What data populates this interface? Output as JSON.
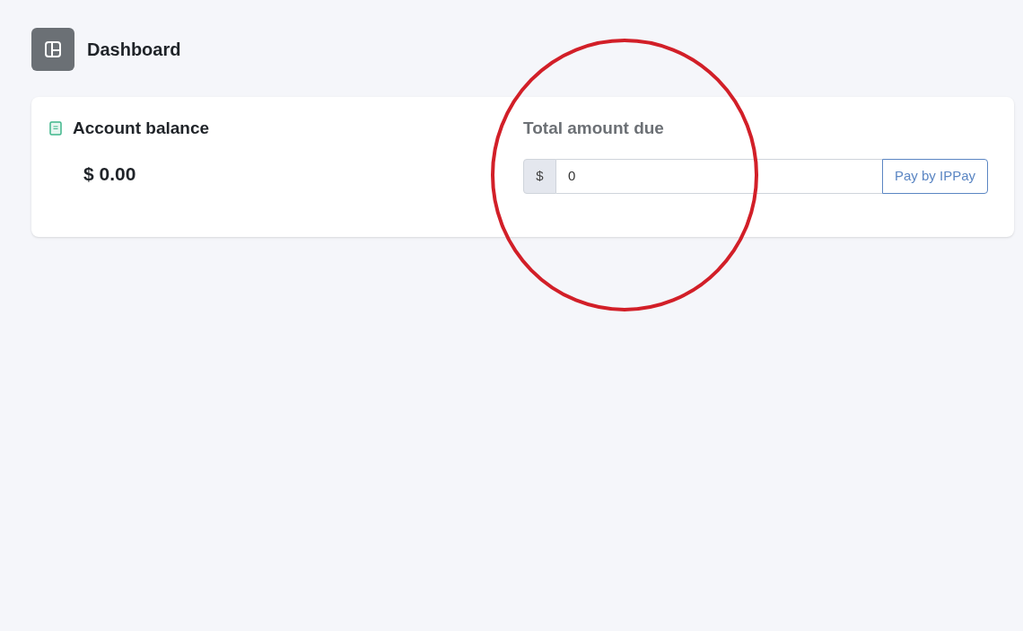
{
  "header": {
    "title": "Dashboard"
  },
  "balance": {
    "label": "Account balance",
    "amount": "$ 0.00"
  },
  "payment": {
    "label": "Total amount due",
    "currency": "$",
    "value": "0",
    "button": "Pay by IPPay"
  }
}
